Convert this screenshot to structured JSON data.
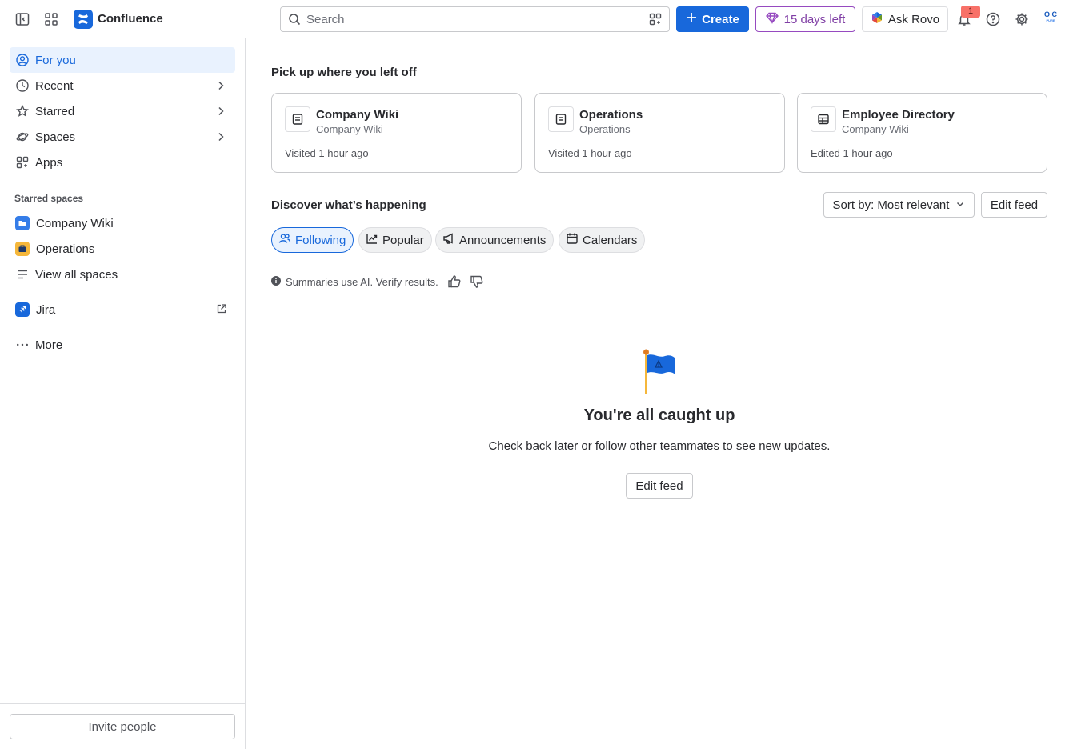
{
  "app": {
    "name": "Confluence"
  },
  "topbar": {
    "search_placeholder": "Search",
    "create_label": "Create",
    "trial_label": "15 days left",
    "rovo_label": "Ask Rovo",
    "notification_count": "1",
    "avatar_initials": "O C",
    "avatar_caption": "PURE"
  },
  "sidebar": {
    "nav": [
      {
        "label": "For you",
        "icon": "user-circle-icon"
      },
      {
        "label": "Recent",
        "icon": "clock-icon"
      },
      {
        "label": "Starred",
        "icon": "star-icon"
      },
      {
        "label": "Spaces",
        "icon": "planet-icon"
      },
      {
        "label": "Apps",
        "icon": "apps-icon"
      }
    ],
    "starred_label": "Starred spaces",
    "spaces": [
      {
        "label": "Company Wiki",
        "color": "#357de8"
      },
      {
        "label": "Operations",
        "color": "#f5b73b"
      }
    ],
    "view_all_label": "View all spaces",
    "jira_label": "Jira",
    "more_label": "More",
    "invite_label": "Invite people"
  },
  "main": {
    "pickup_title": "Pick up where you left off",
    "cards": [
      {
        "title": "Company Wiki",
        "subtitle": "Company Wiki",
        "meta": "Visited 1 hour ago",
        "icon": "page-icon"
      },
      {
        "title": "Operations",
        "subtitle": "Operations",
        "meta": "Visited 1 hour ago",
        "icon": "page-icon"
      },
      {
        "title": "Employee Directory",
        "subtitle": "Company Wiki",
        "meta": "Edited 1 hour ago",
        "icon": "database-icon"
      }
    ],
    "discover_title": "Discover what’s happening",
    "sort_label": "Sort by: Most relevant",
    "edit_feed_label": "Edit feed",
    "tabs": [
      {
        "label": "Following",
        "icon": "people-icon"
      },
      {
        "label": "Popular",
        "icon": "trend-icon"
      },
      {
        "label": "Announcements",
        "icon": "megaphone-icon"
      },
      {
        "label": "Calendars",
        "icon": "calendar-icon"
      }
    ],
    "ai_note": "Summaries use AI. Verify results.",
    "empty_title": "You're all caught up",
    "empty_text": "Check back later or follow other teammates to see new updates.",
    "empty_button": "Edit feed"
  }
}
